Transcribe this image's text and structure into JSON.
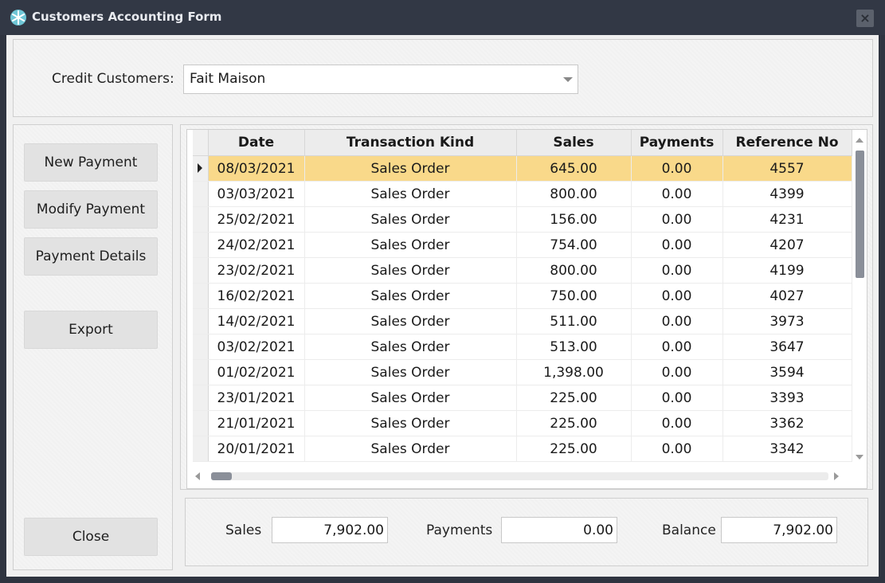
{
  "window": {
    "title": "Customers Accounting Form",
    "close_glyph": "×"
  },
  "customer": {
    "label": "Credit Customers:",
    "selected": "Fait Maison"
  },
  "buttons": {
    "new_payment": "New Payment",
    "modify_payment": "Modify Payment",
    "payment_details": "Payment Details",
    "export": "Export",
    "close": "Close"
  },
  "grid": {
    "columns": [
      "Date",
      "Transaction Kind",
      "Sales",
      "Payments",
      "Reference No"
    ],
    "rows": [
      {
        "date": "08/03/2021",
        "kind": "Sales Order",
        "sales": "645.00",
        "payments": "0.00",
        "ref": "4557"
      },
      {
        "date": "03/03/2021",
        "kind": "Sales Order",
        "sales": "800.00",
        "payments": "0.00",
        "ref": "4399"
      },
      {
        "date": "25/02/2021",
        "kind": "Sales Order",
        "sales": "156.00",
        "payments": "0.00",
        "ref": "4231"
      },
      {
        "date": "24/02/2021",
        "kind": "Sales Order",
        "sales": "754.00",
        "payments": "0.00",
        "ref": "4207"
      },
      {
        "date": "23/02/2021",
        "kind": "Sales Order",
        "sales": "800.00",
        "payments": "0.00",
        "ref": "4199"
      },
      {
        "date": "16/02/2021",
        "kind": "Sales Order",
        "sales": "750.00",
        "payments": "0.00",
        "ref": "4027"
      },
      {
        "date": "14/02/2021",
        "kind": "Sales Order",
        "sales": "511.00",
        "payments": "0.00",
        "ref": "3973"
      },
      {
        "date": "03/02/2021",
        "kind": "Sales Order",
        "sales": "513.00",
        "payments": "0.00",
        "ref": "3647"
      },
      {
        "date": "01/02/2021",
        "kind": "Sales Order",
        "sales": "1,398.00",
        "payments": "0.00",
        "ref": "3594"
      },
      {
        "date": "23/01/2021",
        "kind": "Sales Order",
        "sales": "225.00",
        "payments": "0.00",
        "ref": "3393"
      },
      {
        "date": "21/01/2021",
        "kind": "Sales Order",
        "sales": "225.00",
        "payments": "0.00",
        "ref": "3362"
      },
      {
        "date": "20/01/2021",
        "kind": "Sales Order",
        "sales": "225.00",
        "payments": "0.00",
        "ref": "3342"
      }
    ]
  },
  "totals": {
    "sales_label": "Sales",
    "sales_value": "7,902.00",
    "payments_label": "Payments",
    "payments_value": "0.00",
    "balance_label": "Balance",
    "balance_value": "7,902.00"
  },
  "colors": {
    "selected_row": "#f9d98a",
    "title_bar": "#323845",
    "accent_icon": "#6fc6d6"
  },
  "icons": {
    "app": "snowflake-icon",
    "row_pointer": "row-pointer-icon"
  }
}
